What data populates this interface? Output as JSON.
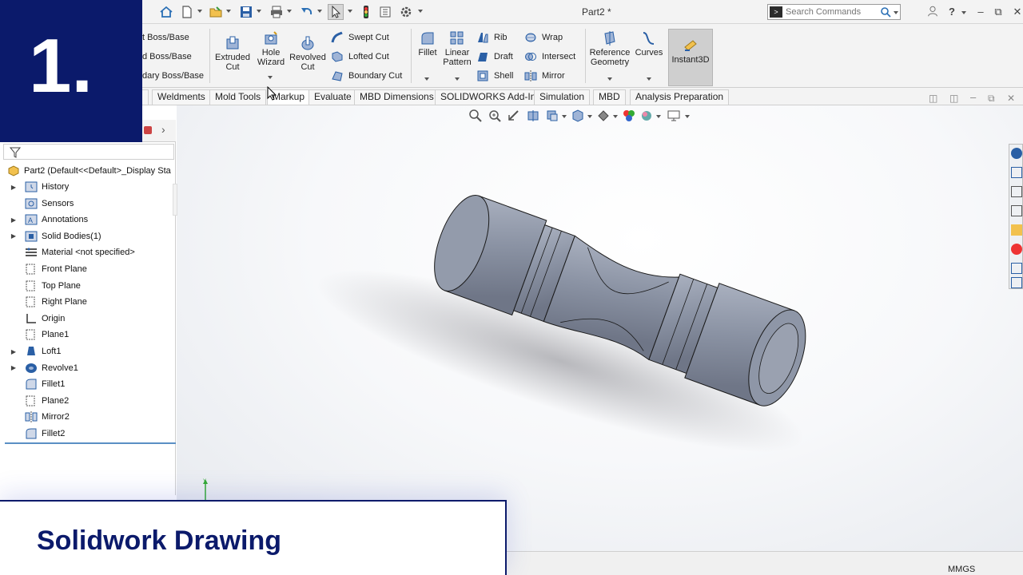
{
  "overlay": {
    "badge_number": "1.",
    "title": "Solidwork Drawing"
  },
  "window": {
    "title": "Part2 *",
    "search_placeholder": "Search Commands"
  },
  "ribbon": {
    "boss_base_items": [
      "t Boss/Base",
      "d Boss/Base",
      "dary Boss/Base"
    ],
    "extruded_cut": [
      "Extruded",
      "Cut"
    ],
    "hole_wizard": [
      "Hole",
      "Wizard"
    ],
    "revolved_cut": [
      "Revolved",
      "Cut"
    ],
    "cut_items": [
      "Swept Cut",
      "Lofted Cut",
      "Boundary Cut"
    ],
    "fillet": "Fillet",
    "linear_pattern": [
      "Linear",
      "Pattern"
    ],
    "feature_items_a": [
      "Rib",
      "Draft",
      "Shell"
    ],
    "feature_items_b": [
      "Wrap",
      "Intersect",
      "Mirror"
    ],
    "reference_geometry": [
      "Reference",
      "Geometry"
    ],
    "curves": "Curves",
    "instant3d": "Instant3D"
  },
  "tabs": [
    "l",
    "Weldments",
    "Mold Tools",
    "Markup",
    "Evaluate",
    "MBD Dimensions",
    "SOLIDWORKS Add-Ins",
    "Simulation",
    "MBD",
    "Analysis Preparation"
  ],
  "tree": {
    "root": "Part2  (Default<<Default>_Display Sta",
    "items": [
      {
        "label": "History",
        "expandable": true,
        "icon": "history-icon"
      },
      {
        "label": "Sensors",
        "expandable": false,
        "icon": "sensors-icon"
      },
      {
        "label": "Annotations",
        "expandable": true,
        "icon": "annotations-icon"
      },
      {
        "label": "Solid Bodies(1)",
        "expandable": true,
        "icon": "solid-bodies-icon"
      },
      {
        "label": "Material <not specified>",
        "expandable": false,
        "icon": "material-icon"
      },
      {
        "label": "Front Plane",
        "expandable": false,
        "icon": "plane-icon"
      },
      {
        "label": "Top Plane",
        "expandable": false,
        "icon": "plane-icon"
      },
      {
        "label": "Right Plane",
        "expandable": false,
        "icon": "plane-icon"
      },
      {
        "label": "Origin",
        "expandable": false,
        "icon": "origin-icon"
      },
      {
        "label": "Plane1",
        "expandable": false,
        "icon": "plane-icon"
      },
      {
        "label": "Loft1",
        "expandable": true,
        "icon": "loft-icon"
      },
      {
        "label": "Revolve1",
        "expandable": true,
        "icon": "revolve-icon"
      },
      {
        "label": "Fillet1",
        "expandable": false,
        "icon": "fillet-icon"
      },
      {
        "label": "Plane2",
        "expandable": false,
        "icon": "plane-icon"
      },
      {
        "label": "Mirror2",
        "expandable": false,
        "icon": "mirror-icon"
      },
      {
        "label": "Fillet2",
        "expandable": false,
        "icon": "fillet-icon"
      }
    ]
  },
  "status": {
    "units": "MMGS"
  },
  "colors": {
    "brand_navy": "#0b1a6b",
    "model_gray": "#8f96a6",
    "accent_blue": "#2a6fb5"
  }
}
